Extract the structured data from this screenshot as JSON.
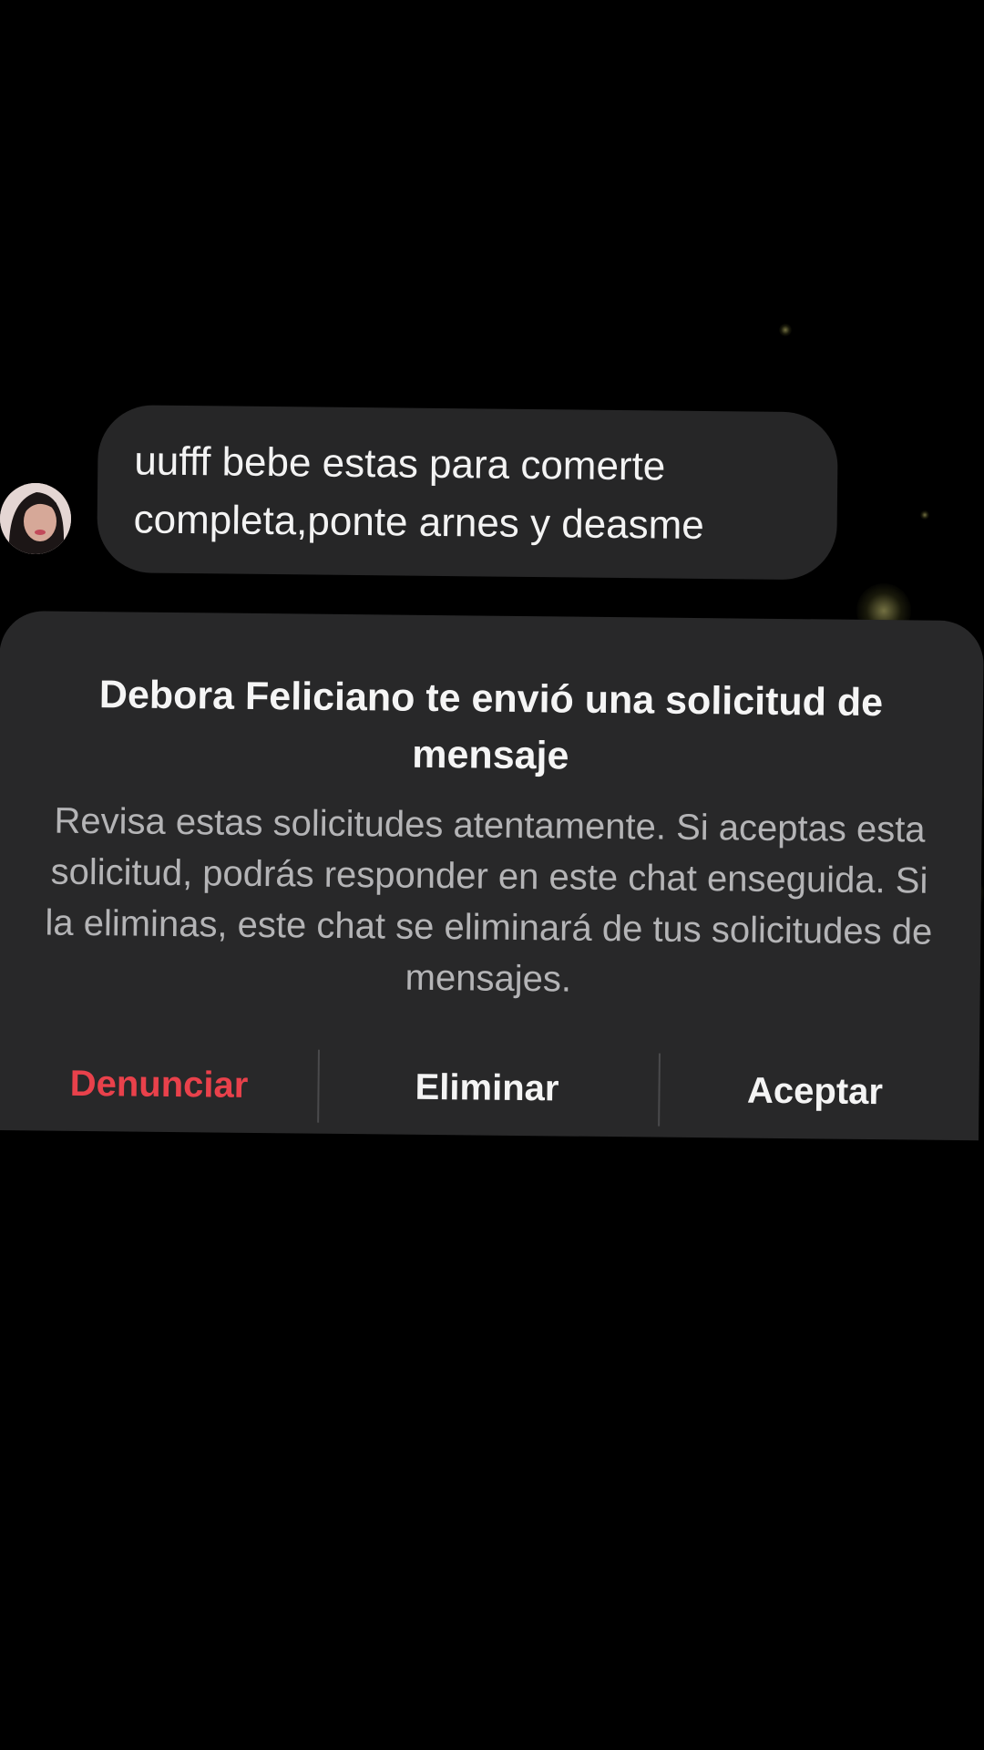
{
  "message": {
    "lines": [
      "uufff bebe estas para comerte",
      "completa,ponte arnes y deasme"
    ]
  },
  "request": {
    "title": "Debora Feliciano te envió una solicitud de mensaje",
    "body": "Revisa estas solicitudes atentamente. Si aceptas esta solicitud, podrás responder en este chat enseguida. Si la eliminas, este chat se eliminará de tus solicitudes de mensajes.",
    "actions": {
      "report": "Denunciar",
      "delete": "Eliminar",
      "accept": "Aceptar"
    }
  },
  "colors": {
    "background": "#000000",
    "bubble": "#262627",
    "panel": "#282829",
    "report": "#e9414b",
    "secondary_text": "#b4b4b6"
  },
  "icons": {
    "avatar": "profile-photo"
  }
}
